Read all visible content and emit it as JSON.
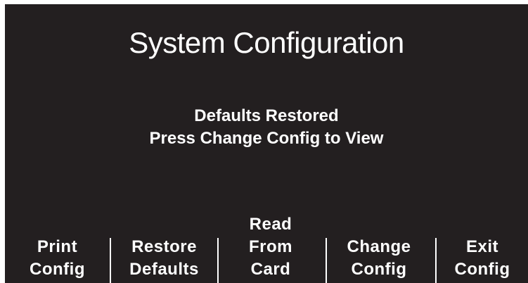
{
  "screen": {
    "title": "System Configuration",
    "status_line_1": "Defaults Restored",
    "status_line_2": "Press Change Config to View"
  },
  "softkeys": [
    {
      "line1": "Print",
      "line2": "Config"
    },
    {
      "line1": "Restore",
      "line2": "Defaults"
    },
    {
      "line1": "Read",
      "line2": "From",
      "line3": "Card"
    },
    {
      "line1": "Change",
      "line2": "Config"
    },
    {
      "line1": "Exit",
      "line2": "Config"
    }
  ],
  "colors": {
    "background": "#231f20",
    "text": "#ffffff"
  }
}
